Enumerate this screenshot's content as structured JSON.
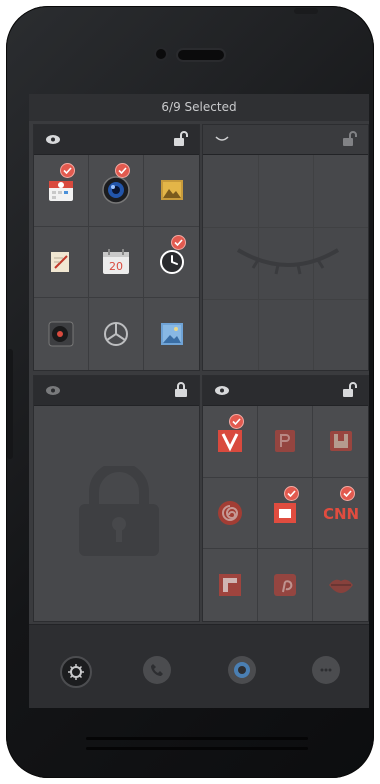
{
  "status_bar": {
    "selection_text": "6/9 Selected"
  },
  "panels": [
    {
      "id": "top-left",
      "visibility": "visible",
      "lock": "unlocked",
      "dimmed": false,
      "apps": [
        {
          "name": "calendar-icon",
          "selected": true
        },
        {
          "name": "camera-icon",
          "selected": true
        },
        {
          "name": "gallery-icon",
          "selected": false
        },
        {
          "name": "notes-icon",
          "selected": false
        },
        {
          "name": "date-icon",
          "label": "20",
          "selected": false
        },
        {
          "name": "clock-icon",
          "selected": true
        },
        {
          "name": "record-player-icon",
          "selected": false
        },
        {
          "name": "mercedes-icon",
          "selected": false
        },
        {
          "name": "photo-icon",
          "selected": false
        }
      ]
    },
    {
      "id": "top-right",
      "visibility": "hidden",
      "lock": "unlocked",
      "dimmed": true
    },
    {
      "id": "bottom-left",
      "visibility": "visible",
      "lock": "locked",
      "dimmed": true
    },
    {
      "id": "bottom-right",
      "visibility": "visible",
      "lock": "unlocked",
      "dimmed": false,
      "apps": [
        {
          "name": "vivino-icon",
          "selected": true
        },
        {
          "name": "pocket-icon",
          "selected": false
        },
        {
          "name": "book-icon",
          "selected": false
        },
        {
          "name": "swirl-icon",
          "selected": false
        },
        {
          "name": "flipboard-tile-icon",
          "selected": true
        },
        {
          "name": "cnn-icon",
          "label": "CNN",
          "selected": true
        },
        {
          "name": "flipboard-icon",
          "selected": false
        },
        {
          "name": "pinterest-icon",
          "selected": false
        },
        {
          "name": "lips-icon",
          "selected": false
        }
      ]
    }
  ],
  "dock": [
    {
      "name": "settings-icon"
    },
    {
      "name": "phone-icon"
    },
    {
      "name": "browser-icon"
    },
    {
      "name": "messages-icon"
    }
  ],
  "colors": {
    "accent_red": "#e25a4f",
    "check_border": "#f4a9a2",
    "panel_bg": "#4b4c4f",
    "header_bg": "#2b2c2f"
  }
}
